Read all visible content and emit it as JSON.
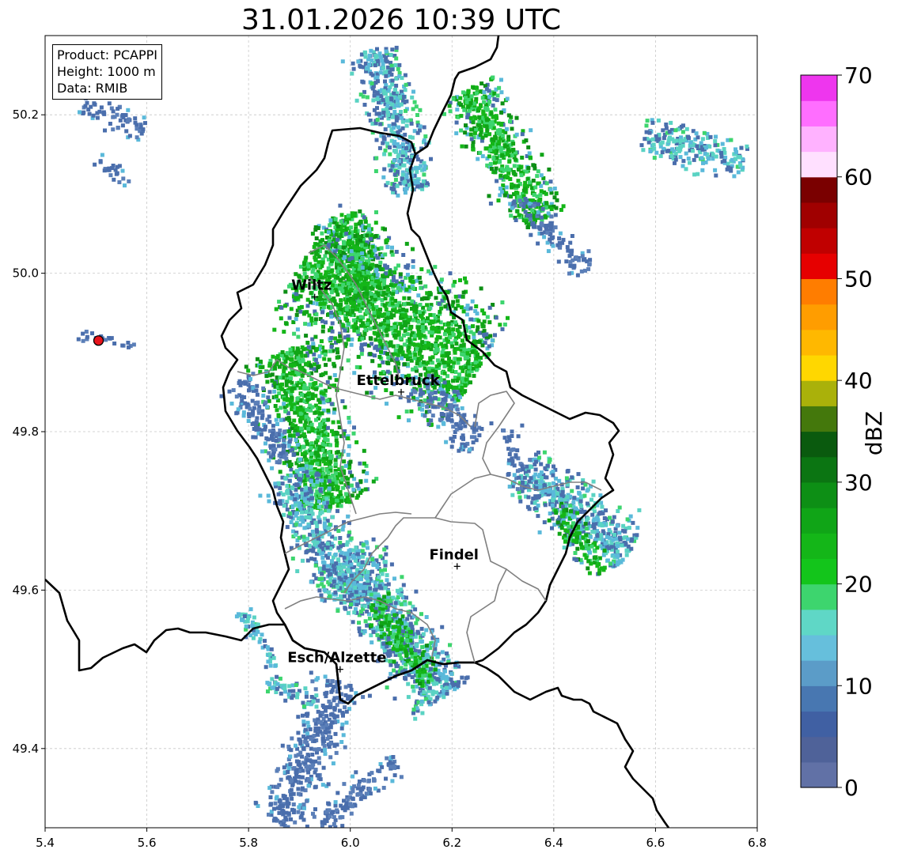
{
  "title": "31.01.2026 10:39 UTC",
  "info_box": {
    "product": "Product: PCAPPI",
    "height": "Height: 1000 m",
    "data": "Data: RMIB"
  },
  "map": {
    "lon_range": [
      5.4,
      6.8
    ],
    "lat_range": [
      49.3,
      50.3
    ],
    "x_ticks": [
      "5.4",
      "5.6",
      "5.8",
      "6.0",
      "6.2",
      "6.4",
      "6.6",
      "6.8"
    ],
    "y_ticks": [
      "49.4",
      "49.6",
      "49.8",
      "50.0",
      "50.2"
    ],
    "grid": "dashed light grey",
    "cities": [
      {
        "name": "Wiltz",
        "lon": 5.93,
        "lat": 49.97
      },
      {
        "name": "Ettelbruck",
        "lon": 6.1,
        "lat": 49.85
      },
      {
        "name": "Findel",
        "lon": 6.21,
        "lat": 49.63
      },
      {
        "name": "Esch/Alzette",
        "lon": 5.98,
        "lat": 49.5
      }
    ],
    "radar_site": {
      "lon": 5.505,
      "lat": 49.915,
      "color": "#e8141c"
    }
  },
  "colorbar": {
    "label": "dBZ",
    "range": [
      0,
      70
    ],
    "tick_labels": [
      "0",
      "10",
      "20",
      "30",
      "40",
      "50",
      "60",
      "70"
    ],
    "colors": [
      "#6171a6",
      "#4f6299",
      "#4060a3",
      "#4877b1",
      "#5b9cc8",
      "#66bfdc",
      "#5fd7c6",
      "#3dd56e",
      "#13c51b",
      "#14b618",
      "#10a517",
      "#0d8f15",
      "#0b7512",
      "#0a5a0e",
      "#44780c",
      "#aab10a",
      "#ffd700",
      "#ffb800",
      "#ff9d00",
      "#ff7d00",
      "#e60000",
      "#c00000",
      "#a00000",
      "#7a0000",
      "#ffe0ff",
      "#ffb2ff",
      "#ff6eff",
      "#ee36ee"
    ]
  },
  "colors": {
    "border_national": "#000000",
    "border_canton": "#808080",
    "echo_weak": "#4a6eac",
    "echo_mid": "#5ab9da",
    "echo_strong": "#14b618"
  }
}
